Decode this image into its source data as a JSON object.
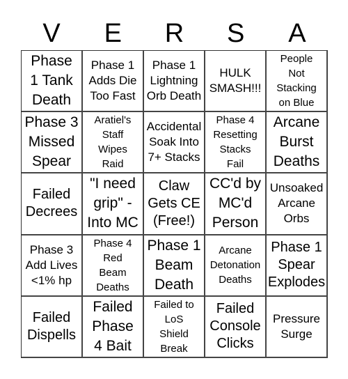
{
  "header": {
    "letters": [
      "V",
      "E",
      "R",
      "S",
      "A"
    ]
  },
  "board": {
    "cells": [
      [
        "Phase\n1 Tank\nDeath",
        "Phase 1\nAdds Die\nToo Fast",
        "Phase 1\nLightning\nOrb Death",
        "HULK\nSMASH!!!",
        "People\nNot\nStacking\non Blue"
      ],
      [
        "Phase 3\nMissed\nSpear",
        "Aratiel's\nStaff\nWipes\nRaid",
        "Accidental\nSoak Into\n7+ Stacks",
        "Phase 4\nResetting\nStacks\nFail",
        "Arcane\nBurst\nDeaths"
      ],
      [
        "Failed\nDecrees",
        "\"I need\ngrip\" -\nInto MC",
        "Claw\nGets CE\n(Free!)",
        "CC'd by\nMC'd\nPerson",
        "Unsoaked\nArcane\nOrbs"
      ],
      [
        "Phase 3\nAdd Lives\n<1% hp",
        "Phase 4\nRed\nBeam\nDeaths",
        "Phase 1\nBeam\nDeath",
        "Arcane\nDetonation\nDeaths",
        "Phase 1\nSpear\nExplodes"
      ],
      [
        "Failed\nDispells",
        "Failed\nPhase\n4 Bait",
        "Failed to\nLoS\nShield\nBreak",
        "Failed\nConsole\nClicks",
        "Pressure\nSurge"
      ]
    ]
  }
}
